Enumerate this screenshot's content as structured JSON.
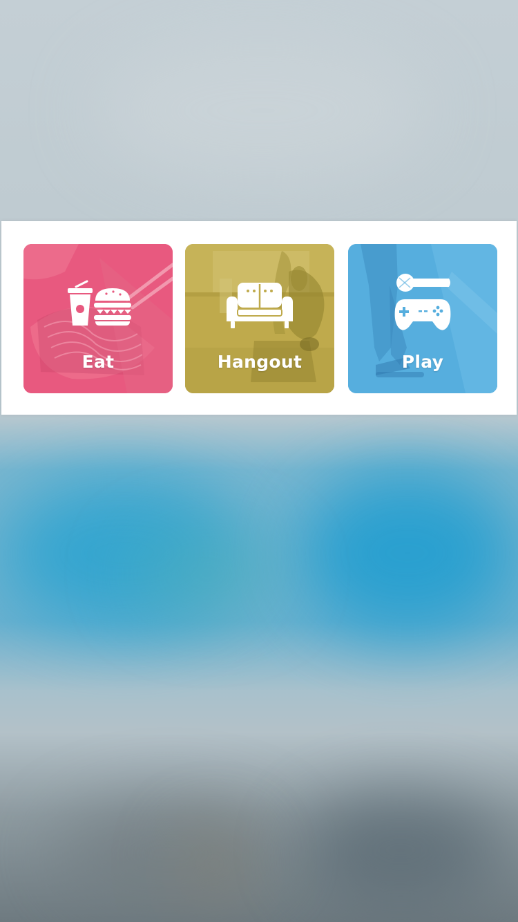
{
  "categories": [
    {
      "label": "Eat",
      "icon": "food-drink-icon",
      "color": "#e8597f"
    },
    {
      "label": "Hangout",
      "icon": "sofa-icon",
      "color": "#bfaa4c"
    },
    {
      "label": "Play",
      "icon": "microphone-gamepad-icon",
      "color": "#56aede"
    }
  ]
}
